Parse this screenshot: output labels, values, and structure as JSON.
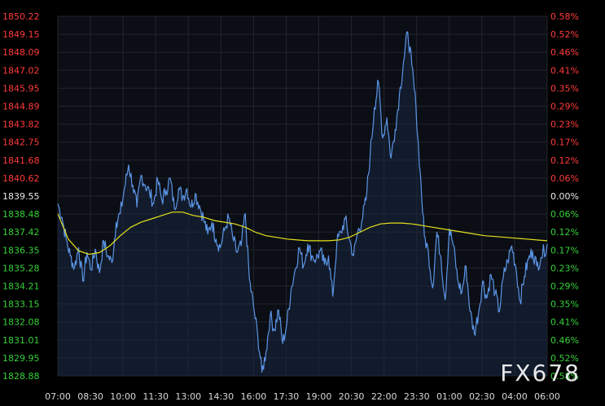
{
  "watermark": "FX678",
  "colors": {
    "background": "#000000",
    "plot_background": "#0b0e15",
    "grid": "#23262d",
    "price_line": "#5b95e6",
    "area_fill": "#1a2740",
    "average_line": "#e6e21c",
    "axis_text_white": "#e8e8e8",
    "axis_text_red": "#ff3b3b",
    "axis_text_green": "#36d13a",
    "bottom_text": "#d8d8d8"
  },
  "chart_data": {
    "type": "line",
    "title": "",
    "xlabel": "",
    "ylabel": "",
    "x_ticks": [
      "07:00",
      "08:30",
      "10:00",
      "11:30",
      "13:00",
      "14:30",
      "16:00",
      "17:30",
      "19:00",
      "20:30",
      "22:00",
      "23:30",
      "01:00",
      "02:30",
      "04:00",
      "06:00"
    ],
    "y_ticks_left": [
      "1850.22",
      "1849.15",
      "1848.09",
      "1847.02",
      "1845.95",
      "1844.89",
      "1843.82",
      "1842.75",
      "1841.68",
      "1840.62",
      "1839.55",
      "1838.48",
      "1837.42",
      "1836.35",
      "1835.28",
      "1834.21",
      "1833.15",
      "1832.08",
      "1831.01",
      "1829.95",
      "1828.88"
    ],
    "y_ticks_right": [
      "0.58%",
      "0.52%",
      "0.46%",
      "0.41%",
      "0.35%",
      "0.29%",
      "0.23%",
      "0.17%",
      "0.12%",
      "0.06%",
      "0.00%",
      "0.06%",
      "0.12%",
      "0.17%",
      "0.23%",
      "0.29%",
      "0.35%",
      "0.41%",
      "0.46%",
      "0.52%",
      "0.58%"
    ],
    "reference_value": 1839.55,
    "ylim": [
      1828.88,
      1850.22
    ],
    "x_range_hours": 23.5,
    "grid": true,
    "series": [
      {
        "role": "price",
        "points": [
          [
            0.0,
            1839.1
          ],
          [
            0.2,
            1838.3
          ],
          [
            0.4,
            1837.0
          ],
          [
            0.6,
            1836.0
          ],
          [
            0.8,
            1835.3
          ],
          [
            1.0,
            1836.5
          ],
          [
            1.2,
            1834.5
          ],
          [
            1.4,
            1836.2
          ],
          [
            1.6,
            1835.2
          ],
          [
            1.8,
            1836.4
          ],
          [
            2.0,
            1835.0
          ],
          [
            2.2,
            1836.9
          ],
          [
            2.4,
            1836.0
          ],
          [
            2.6,
            1835.6
          ],
          [
            2.8,
            1838.0
          ],
          [
            3.0,
            1838.5
          ],
          [
            3.2,
            1840.0
          ],
          [
            3.4,
            1841.4
          ],
          [
            3.6,
            1840.2
          ],
          [
            3.8,
            1838.9
          ],
          [
            4.0,
            1840.8
          ],
          [
            4.2,
            1840.2
          ],
          [
            4.4,
            1839.8
          ],
          [
            4.6,
            1839.1
          ],
          [
            4.8,
            1840.5
          ],
          [
            5.0,
            1839.3
          ],
          [
            5.2,
            1839.9
          ],
          [
            5.4,
            1840.6
          ],
          [
            5.6,
            1838.8
          ],
          [
            5.8,
            1840.0
          ],
          [
            6.0,
            1839.5
          ],
          [
            6.2,
            1840.0
          ],
          [
            6.4,
            1838.9
          ],
          [
            6.6,
            1839.7
          ],
          [
            6.8,
            1839.0
          ],
          [
            7.0,
            1838.2
          ],
          [
            7.2,
            1837.3
          ],
          [
            7.4,
            1838.0
          ],
          [
            7.6,
            1837.0
          ],
          [
            7.8,
            1836.5
          ],
          [
            8.0,
            1837.5
          ],
          [
            8.2,
            1838.3
          ],
          [
            8.4,
            1837.1
          ],
          [
            8.6,
            1836.2
          ],
          [
            8.8,
            1836.6
          ],
          [
            9.0,
            1838.5
          ],
          [
            9.2,
            1834.6
          ],
          [
            9.4,
            1833.0
          ],
          [
            9.6,
            1831.3
          ],
          [
            9.8,
            1829.1
          ],
          [
            10.0,
            1830.3
          ],
          [
            10.2,
            1832.5
          ],
          [
            10.4,
            1831.6
          ],
          [
            10.6,
            1832.8
          ],
          [
            10.8,
            1830.8
          ],
          [
            11.0,
            1832.0
          ],
          [
            11.2,
            1834.0
          ],
          [
            11.4,
            1835.2
          ],
          [
            11.6,
            1836.5
          ],
          [
            11.8,
            1835.4
          ],
          [
            12.0,
            1836.7
          ],
          [
            12.2,
            1836.0
          ],
          [
            12.4,
            1835.8
          ],
          [
            12.6,
            1836.3
          ],
          [
            12.8,
            1835.5
          ],
          [
            13.0,
            1836.0
          ],
          [
            13.2,
            1833.6
          ],
          [
            13.4,
            1836.8
          ],
          [
            13.6,
            1837.4
          ],
          [
            13.8,
            1838.2
          ],
          [
            14.0,
            1837.0
          ],
          [
            14.2,
            1836.0
          ],
          [
            14.4,
            1837.4
          ],
          [
            14.6,
            1838.1
          ],
          [
            14.8,
            1839.3
          ],
          [
            15.0,
            1842.0
          ],
          [
            15.2,
            1844.8
          ],
          [
            15.4,
            1846.3
          ],
          [
            15.6,
            1843.0
          ],
          [
            15.8,
            1844.2
          ],
          [
            16.0,
            1841.8
          ],
          [
            16.2,
            1843.5
          ],
          [
            16.4,
            1845.5
          ],
          [
            16.6,
            1847.5
          ],
          [
            16.8,
            1849.3
          ],
          [
            17.0,
            1847.3
          ],
          [
            17.2,
            1844.8
          ],
          [
            17.4,
            1841.0
          ],
          [
            17.6,
            1837.2
          ],
          [
            17.8,
            1836.2
          ],
          [
            18.0,
            1834.1
          ],
          [
            18.2,
            1837.4
          ],
          [
            18.4,
            1835.9
          ],
          [
            18.6,
            1833.4
          ],
          [
            18.8,
            1837.6
          ],
          [
            19.0,
            1836.6
          ],
          [
            19.2,
            1834.6
          ],
          [
            19.4,
            1833.8
          ],
          [
            19.6,
            1835.4
          ],
          [
            19.8,
            1832.7
          ],
          [
            20.0,
            1831.4
          ],
          [
            20.2,
            1832.6
          ],
          [
            20.4,
            1834.5
          ],
          [
            20.6,
            1833.5
          ],
          [
            20.8,
            1834.9
          ],
          [
            21.0,
            1833.8
          ],
          [
            21.2,
            1832.7
          ],
          [
            21.4,
            1834.8
          ],
          [
            21.6,
            1835.7
          ],
          [
            21.8,
            1836.6
          ],
          [
            22.0,
            1835.3
          ],
          [
            22.2,
            1833.3
          ],
          [
            22.4,
            1834.8
          ],
          [
            22.6,
            1835.8
          ],
          [
            22.8,
            1836.3
          ],
          [
            23.0,
            1835.4
          ],
          [
            23.2,
            1835.9
          ],
          [
            23.5,
            1836.7
          ]
        ]
      },
      {
        "role": "average",
        "points": [
          [
            0.0,
            1838.5
          ],
          [
            0.5,
            1837.0
          ],
          [
            1.0,
            1836.3
          ],
          [
            1.5,
            1836.1
          ],
          [
            2.0,
            1836.2
          ],
          [
            2.5,
            1836.6
          ],
          [
            3.0,
            1837.2
          ],
          [
            3.5,
            1837.7
          ],
          [
            4.0,
            1838.0
          ],
          [
            4.5,
            1838.2
          ],
          [
            5.0,
            1838.4
          ],
          [
            5.5,
            1838.6
          ],
          [
            6.0,
            1838.6
          ],
          [
            6.5,
            1838.4
          ],
          [
            7.0,
            1838.3
          ],
          [
            7.5,
            1838.1
          ],
          [
            8.0,
            1838.0
          ],
          [
            8.5,
            1837.9
          ],
          [
            9.0,
            1837.7
          ],
          [
            9.5,
            1837.4
          ],
          [
            10.0,
            1837.2
          ],
          [
            10.5,
            1837.1
          ],
          [
            11.0,
            1837.0
          ],
          [
            11.5,
            1836.95
          ],
          [
            12.0,
            1836.9
          ],
          [
            12.5,
            1836.9
          ],
          [
            13.0,
            1836.9
          ],
          [
            13.5,
            1836.95
          ],
          [
            14.0,
            1837.1
          ],
          [
            14.5,
            1837.4
          ],
          [
            15.0,
            1837.7
          ],
          [
            15.5,
            1837.9
          ],
          [
            16.0,
            1837.95
          ],
          [
            16.5,
            1837.95
          ],
          [
            17.0,
            1837.9
          ],
          [
            17.5,
            1837.8
          ],
          [
            18.0,
            1837.7
          ],
          [
            18.5,
            1837.6
          ],
          [
            19.0,
            1837.5
          ],
          [
            19.5,
            1837.4
          ],
          [
            20.0,
            1837.3
          ],
          [
            20.5,
            1837.2
          ],
          [
            21.0,
            1837.15
          ],
          [
            21.5,
            1837.1
          ],
          [
            22.0,
            1837.05
          ],
          [
            22.5,
            1837.0
          ],
          [
            23.0,
            1836.95
          ],
          [
            23.5,
            1836.9
          ]
        ]
      }
    ]
  }
}
